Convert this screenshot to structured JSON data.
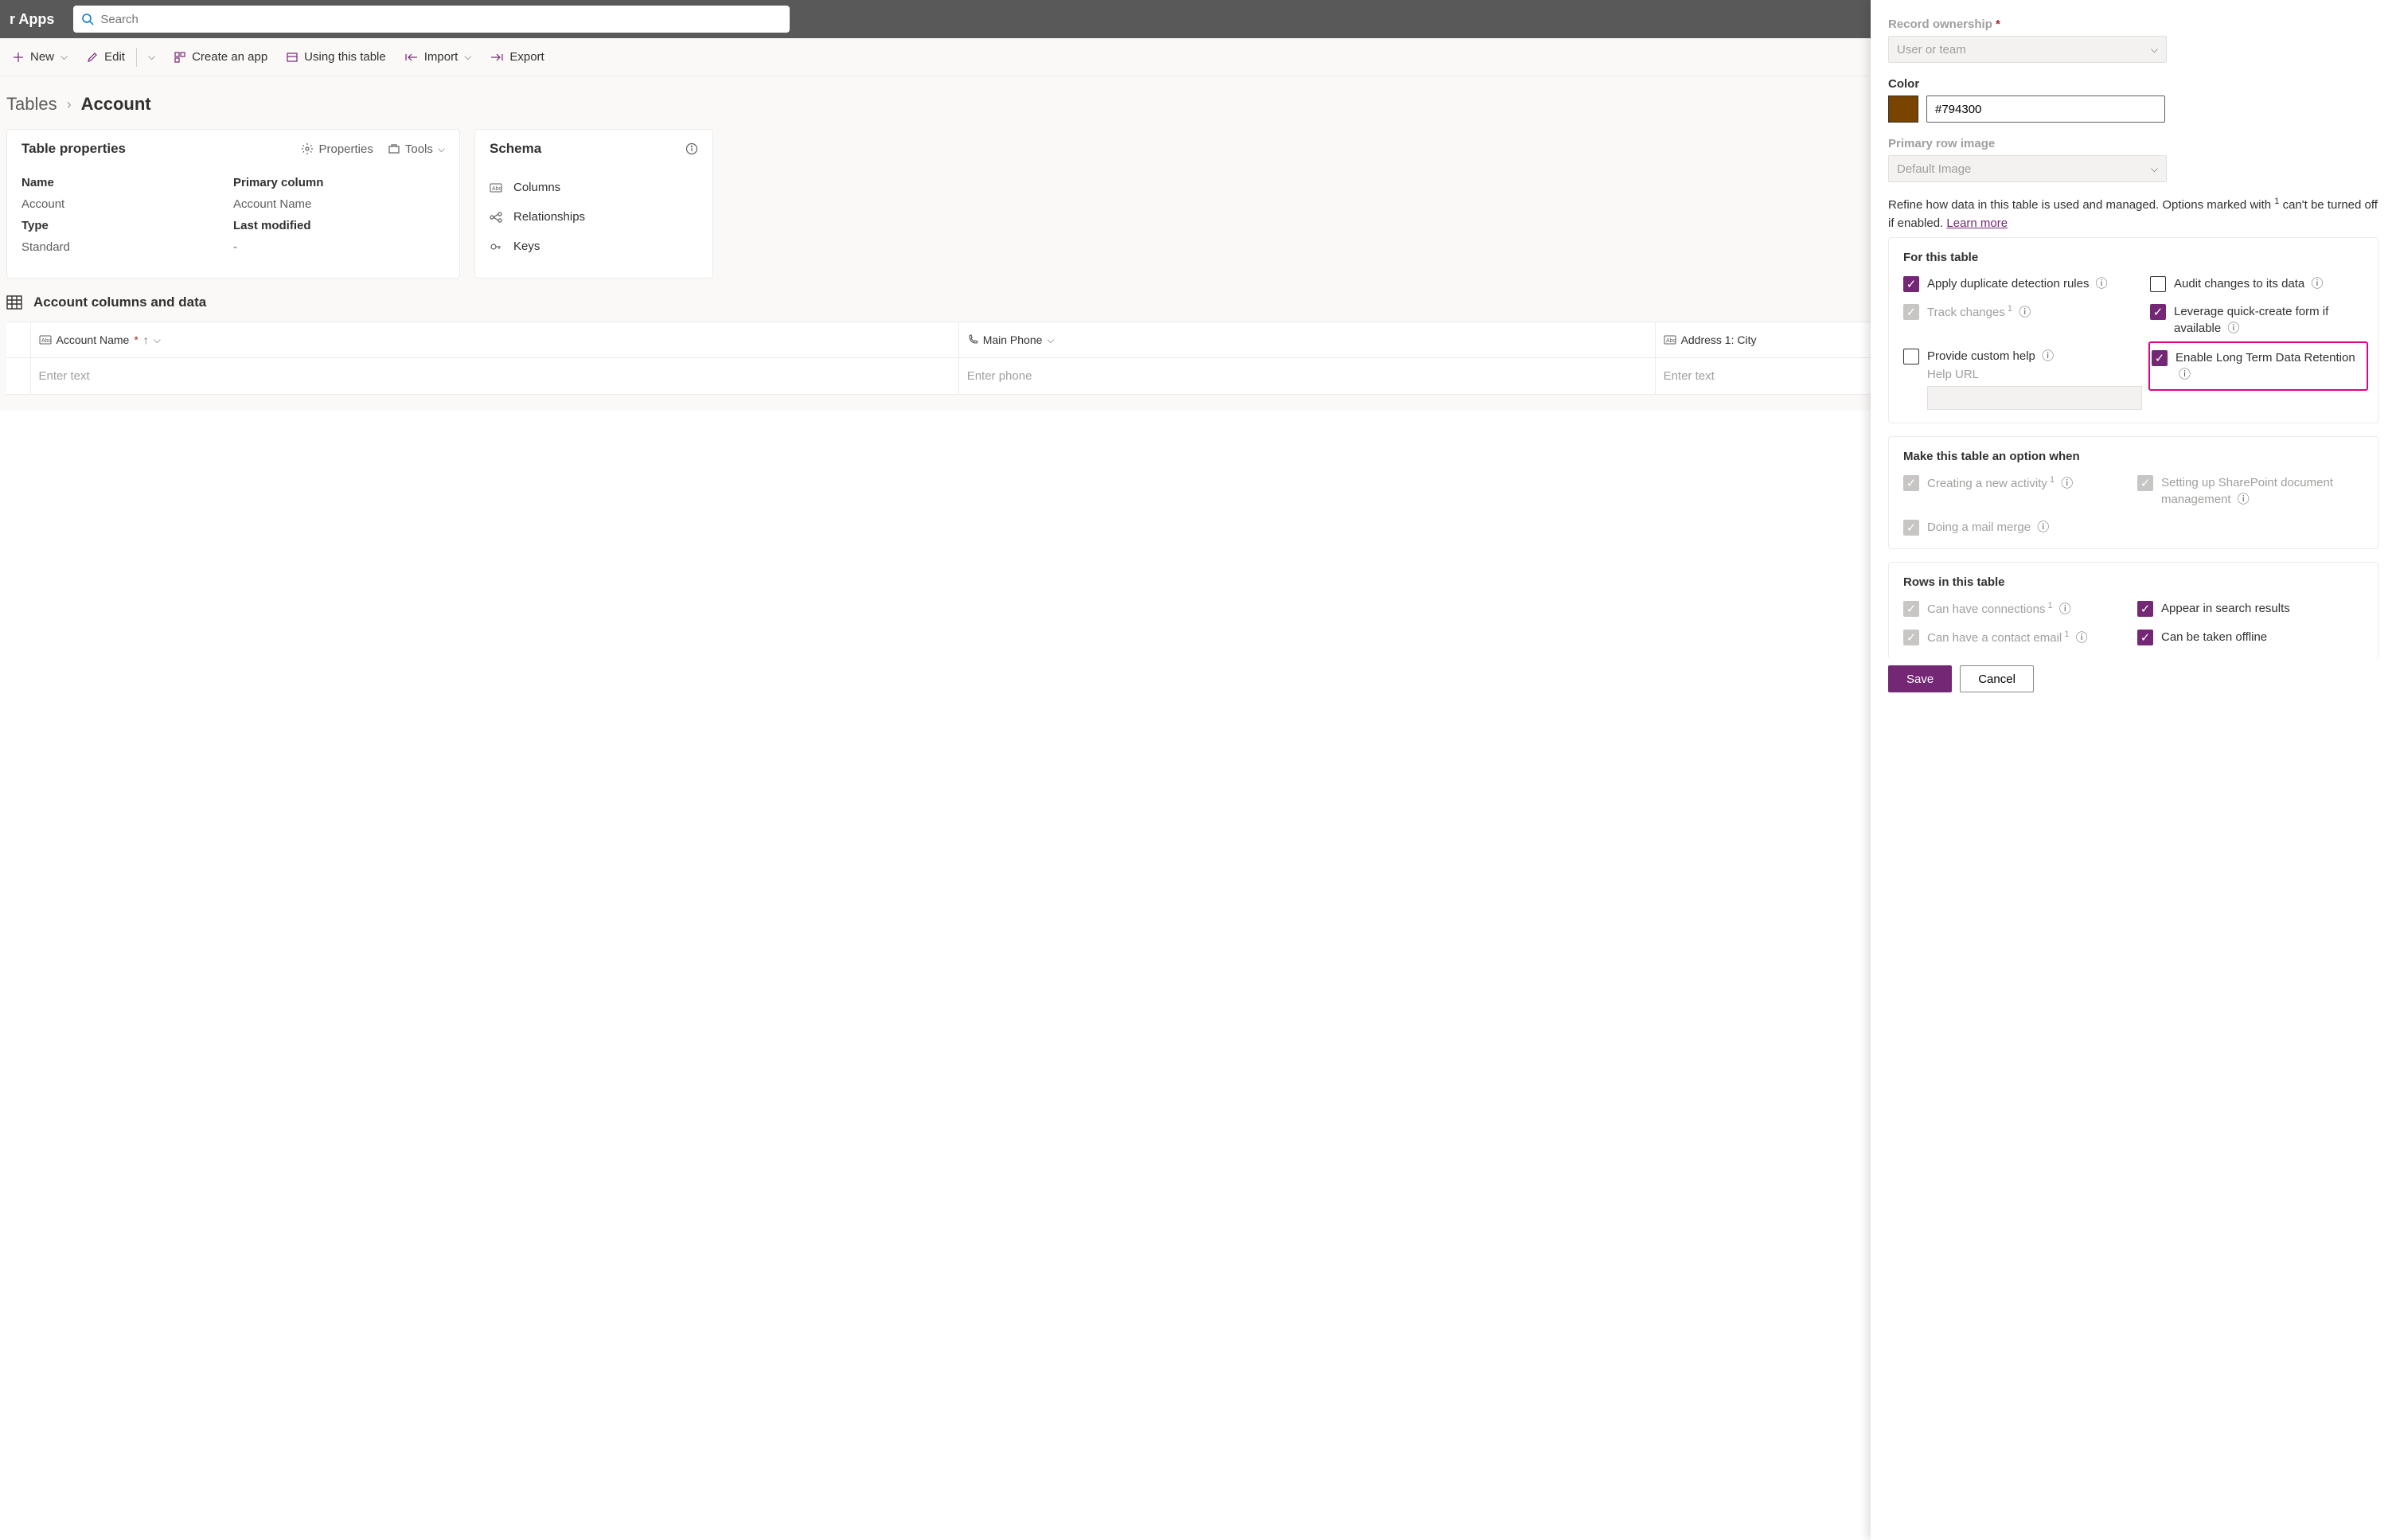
{
  "header": {
    "brand": "r Apps",
    "search_placeholder": "Search"
  },
  "cmdbar": {
    "new": "New",
    "edit": "Edit",
    "createapp": "Create an app",
    "usingtable": "Using this table",
    "import": "Import",
    "export": "Export"
  },
  "breadcrumb": {
    "root": "Tables",
    "current": "Account"
  },
  "props_card": {
    "title": "Table properties",
    "act_properties": "Properties",
    "act_tools": "Tools",
    "name_lbl": "Name",
    "name_val": "Account",
    "primary_lbl": "Primary column",
    "primary_val": "Account Name",
    "type_lbl": "Type",
    "type_val": "Standard",
    "lastmod_lbl": "Last modified",
    "lastmod_val": "-"
  },
  "schema_card": {
    "title": "Schema",
    "columns": "Columns",
    "relationships": "Relationships",
    "keys": "Keys"
  },
  "coldata": {
    "title": "Account columns and data",
    "col_account_name": "Account Name",
    "col_main_phone": "Main Phone",
    "col_address": "Address 1: City",
    "ph_text": "Enter text",
    "ph_phone": "Enter phone"
  },
  "panel": {
    "record_ownership_lbl": "Record ownership",
    "record_ownership_val": "User or team",
    "color_lbl": "Color",
    "color_val": "#794300",
    "primary_img_lbl": "Primary row image",
    "primary_img_val": "Default Image",
    "refine_text_a": "Refine how data in this table is used and managed. Options marked with ",
    "refine_text_b": " can't be turned off if enabled. ",
    "learn_more": "Learn more",
    "s1_title": "For this table",
    "s1_dup": "Apply duplicate detection rules",
    "s1_audit": "Audit changes to its data",
    "s1_track": "Track changes",
    "s1_quick": "Leverage quick-create form if available",
    "s1_customhelp": "Provide custom help",
    "s1_longterm": "Enable Long Term Data Retention",
    "s1_helpurl": "Help URL",
    "s2_title": "Make this table an option when",
    "s2_newact": "Creating a new activity",
    "s2_sharepoint": "Setting up SharePoint document management",
    "s2_mailmerge": "Doing a mail merge",
    "s3_title": "Rows in this table",
    "s3_conn": "Can have connections",
    "s3_search": "Appear in search results",
    "s3_contact": "Can have a contact email",
    "s3_offline": "Can be taken offline",
    "save": "Save",
    "cancel": "Cancel"
  }
}
